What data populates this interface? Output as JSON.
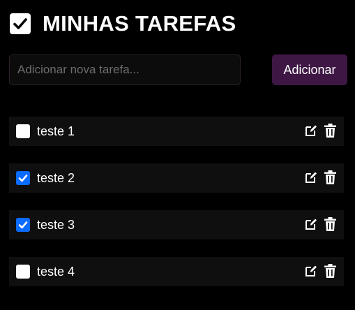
{
  "header": {
    "title": "MINHAS TAREFAS",
    "icon": "checkbox-checked-icon"
  },
  "new_task": {
    "placeholder": "Adicionar nova tarefa...",
    "value": "",
    "add_label": "Adicionar"
  },
  "colors": {
    "background": "#000000",
    "accent": "#3e1745",
    "checked": "#0a6cff",
    "item_bg": "#0f0f0f"
  },
  "tasks": [
    {
      "label": "teste 1",
      "done": false
    },
    {
      "label": "teste 2",
      "done": true
    },
    {
      "label": "teste 3",
      "done": true
    },
    {
      "label": "teste 4",
      "done": false
    }
  ]
}
